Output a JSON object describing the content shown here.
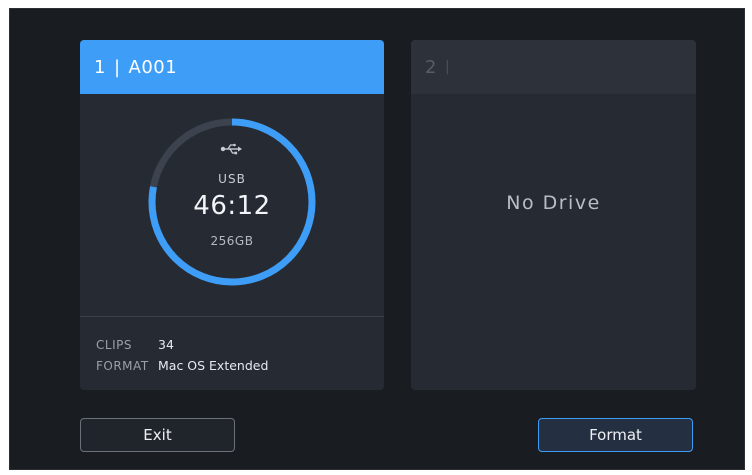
{
  "colors": {
    "accent": "#3d9df7",
    "background": "#191c21",
    "panel": "#262b33"
  },
  "slot1": {
    "number": "1",
    "separator": "|",
    "name": "A001",
    "icon": "usb-icon",
    "connection": "USB",
    "remaining_time": "46:12",
    "capacity": "256GB",
    "remaining_fraction": 0.78,
    "info": [
      {
        "label": "CLIPS",
        "value": "34"
      },
      {
        "label": "FORMAT",
        "value": "Mac OS Extended"
      }
    ]
  },
  "slot2": {
    "number": "2",
    "separator": "|",
    "status": "No Drive"
  },
  "buttons": {
    "exit": "Exit",
    "format": "Format"
  }
}
